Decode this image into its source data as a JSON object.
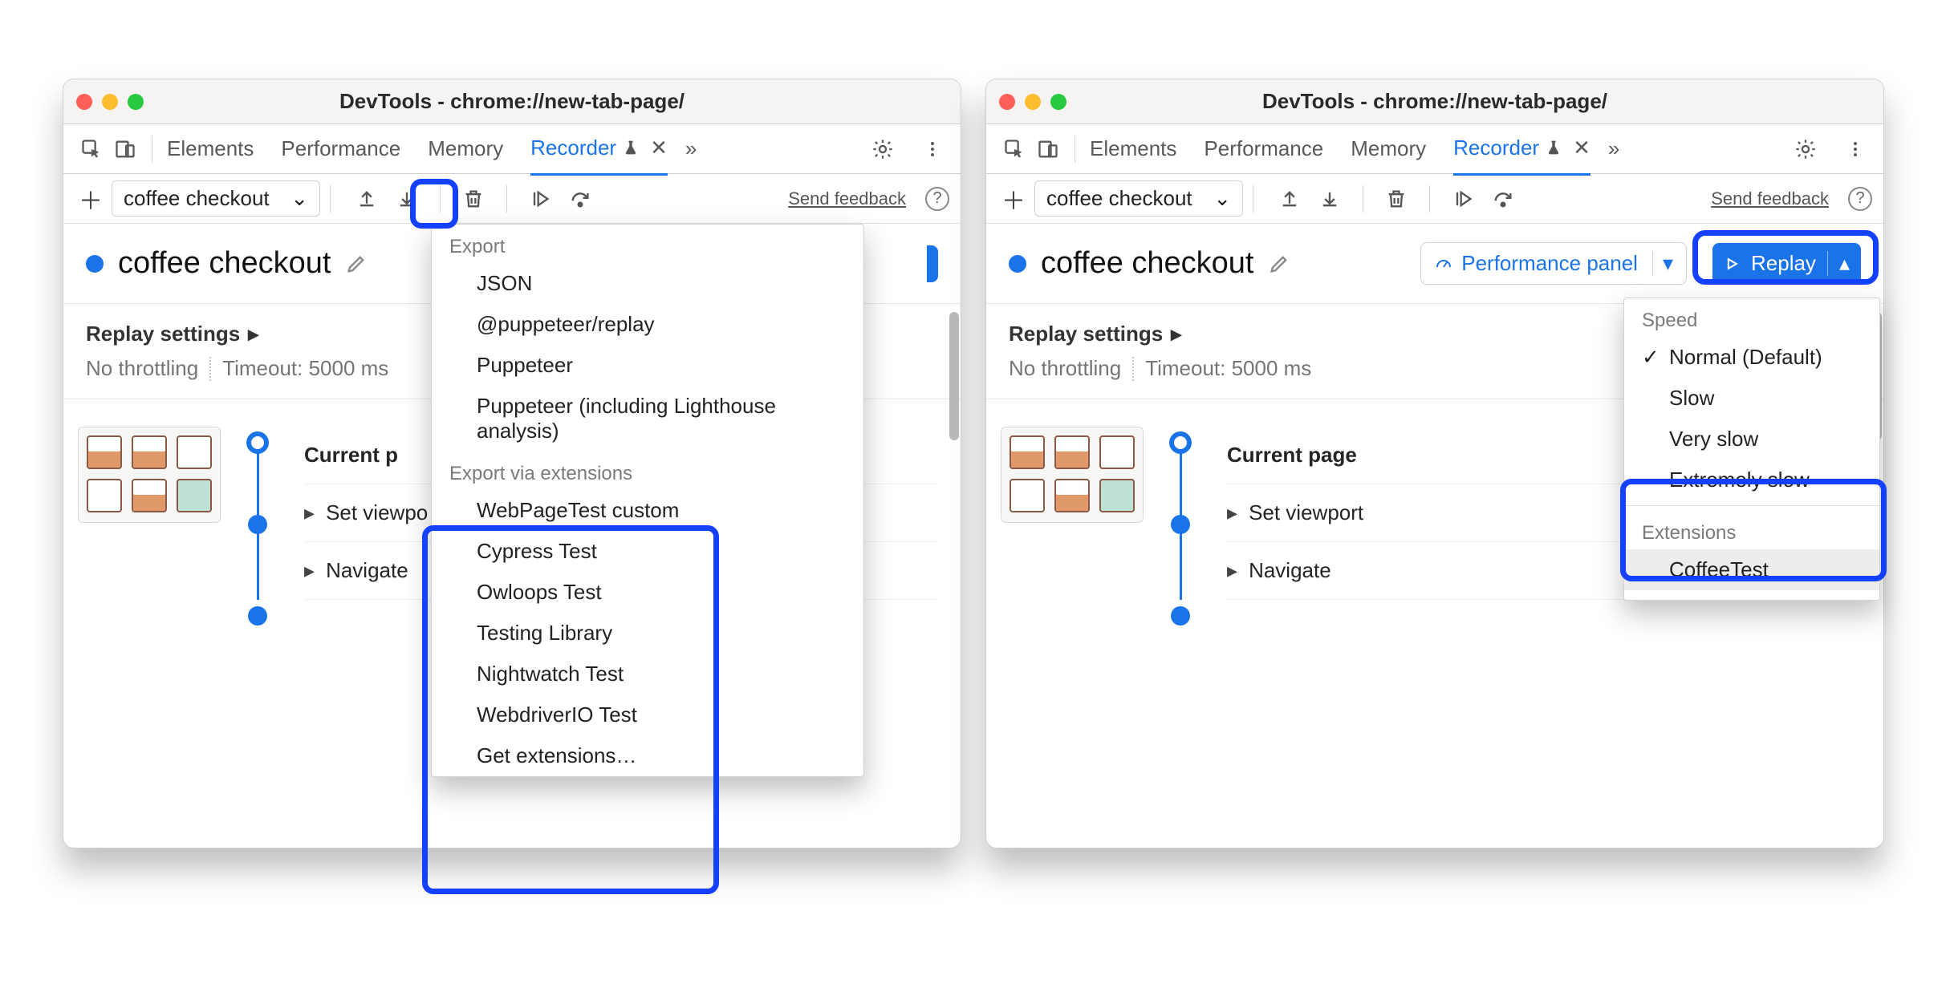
{
  "titlebar": {
    "title": "DevTools - chrome://new-tab-page/"
  },
  "tabs": {
    "elements": "Elements",
    "performance": "Performance",
    "memory": "Memory",
    "recorder": "Recorder"
  },
  "toolbar": {
    "recording_name": "coffee checkout",
    "send_feedback": "Send feedback"
  },
  "recordingHeader": {
    "name": "coffee checkout",
    "perf_panel": "Performance panel",
    "replay": "Replay"
  },
  "settings": {
    "label": "Replay settings",
    "throttling": "No throttling",
    "timeout": "Timeout: 5000 ms"
  },
  "steps": {
    "current": "Current page",
    "current_short": "Current p",
    "set_viewport": "Set viewport",
    "set_viewport_short": "Set viewpo",
    "navigate": "Navigate"
  },
  "exportMenu": {
    "section1": "Export",
    "json": "JSON",
    "puppeteer_replay": "@puppeteer/replay",
    "puppeteer": "Puppeteer",
    "puppeteer_lh": "Puppeteer (including Lighthouse analysis)",
    "section2": "Export via extensions",
    "wpt": "WebPageTest custom",
    "cypress": "Cypress Test",
    "owloops": "Owloops Test",
    "testing_library": "Testing Library",
    "nightwatch": "Nightwatch Test",
    "webdriverio": "WebdriverIO Test",
    "get_ext": "Get extensions…"
  },
  "replayMenu": {
    "section1": "Speed",
    "normal": "Normal (Default)",
    "slow": "Slow",
    "very_slow": "Very slow",
    "extremely_slow": "Extremely slow",
    "section2": "Extensions",
    "coffeetest": "CoffeeTest"
  }
}
